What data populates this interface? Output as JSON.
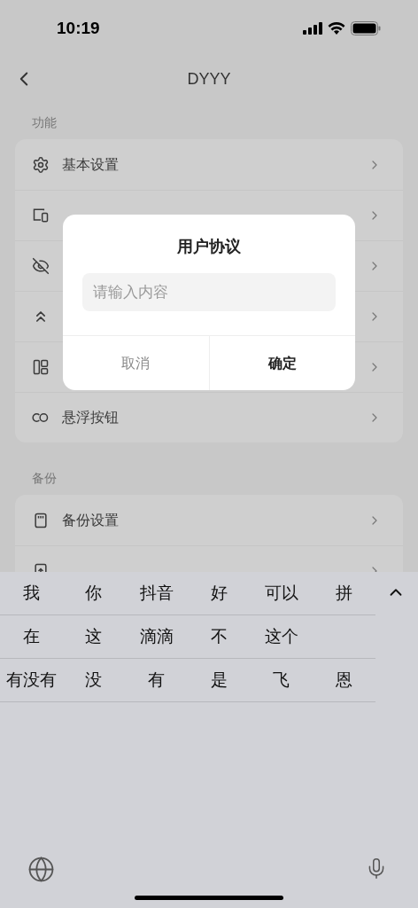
{
  "status_bar": {
    "time": "10:19"
  },
  "nav": {
    "title": "DYYY"
  },
  "sections": [
    {
      "header": "功能",
      "rows": [
        {
          "kind": "gear",
          "label": "基本设置"
        },
        {
          "kind": "device"
        },
        {
          "kind": "eye-off"
        },
        {
          "kind": "chevrons-up"
        },
        {
          "kind": "layout"
        },
        {
          "kind": "co",
          "label": "悬浮按钮"
        }
      ]
    },
    {
      "header": "备份",
      "rows": [
        {
          "kind": "card",
          "label": "备份设置"
        },
        {
          "kind": "restore"
        }
      ]
    }
  ],
  "dialog": {
    "title": "用户协议",
    "field": {
      "placeholder": "请输入内容"
    },
    "buttons": [
      {
        "label": "取消",
        "kind": "cancel"
      },
      {
        "label": "确定",
        "kind": "confirm"
      }
    ]
  },
  "keyboard": {
    "candidate_rows": [
      [
        "我",
        "你",
        "抖音",
        "好",
        "可以",
        "拼"
      ],
      [
        "在",
        "这",
        "滴滴",
        "不",
        "这个"
      ],
      [
        "有没有",
        "没",
        "有",
        "是",
        "飞",
        "恩"
      ]
    ]
  }
}
